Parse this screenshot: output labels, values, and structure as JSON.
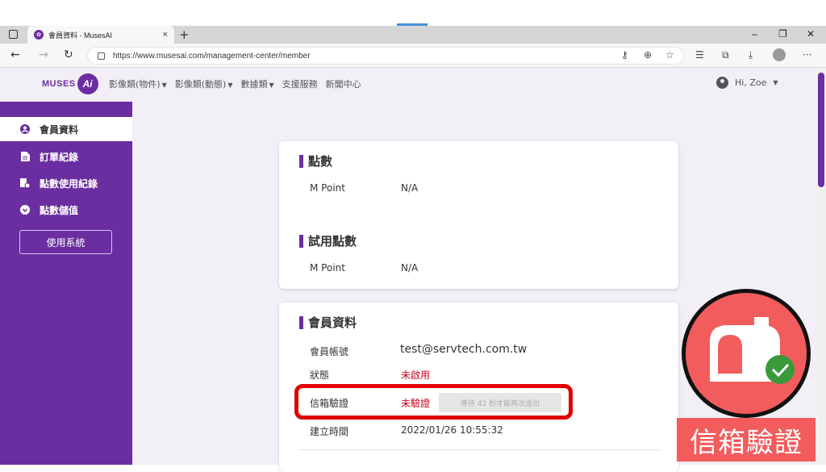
{
  "browser": {
    "tab_title": "會員資料 - MusesAI",
    "tab_close": "×",
    "new_tab": "+",
    "url": "https://www.musesai.com/management-center/member",
    "win_minimize": "–",
    "win_restore": "❐",
    "win_close": "✕",
    "more": "···"
  },
  "site": {
    "logo_text": "MUSES",
    "logo_ai": "Ai",
    "menu": [
      {
        "label": "影像類(物件)",
        "dropdown": true
      },
      {
        "label": "影像類(動態)",
        "dropdown": true
      },
      {
        "label": "數據類",
        "dropdown": true
      },
      {
        "label": "支援服務",
        "dropdown": false
      },
      {
        "label": "新聞中心",
        "dropdown": false
      }
    ],
    "user_greeting": "Hi, Zoe"
  },
  "sidebar": {
    "items": [
      {
        "label": "會員資料",
        "icon": "user-circle-icon",
        "active": true
      },
      {
        "label": "訂單紀錄",
        "icon": "document-icon",
        "active": false
      },
      {
        "label": "點數使用紀錄",
        "icon": "receipt-icon",
        "active": false
      },
      {
        "label": "點數儲值",
        "icon": "coin-icon",
        "active": false
      }
    ],
    "button_label": "使用系統"
  },
  "points_card": {
    "title": "點數",
    "label": "M Point",
    "value": "N/A",
    "trial_title": "試用點數",
    "trial_label": "M Point",
    "trial_value": "N/A"
  },
  "member_card": {
    "title": "會員資料",
    "account_label": "會員帳號",
    "account_value": "test@servtech.com.tw",
    "status_label": "狀態",
    "status_value": "未啟用",
    "email_verify_label": "信箱驗證",
    "email_verify_value": "未驗證",
    "resend_button": "等待 42 秒才能再次送出",
    "created_label": "建立時間",
    "created_value": "2022/01/26 10:55:32"
  },
  "overlay": {
    "caption": "信箱驗證",
    "icon": "mailbox-check-icon"
  },
  "colors": {
    "brand": "#6a2ea0",
    "alert": "#d0021b",
    "badge": "#f25c5c"
  }
}
